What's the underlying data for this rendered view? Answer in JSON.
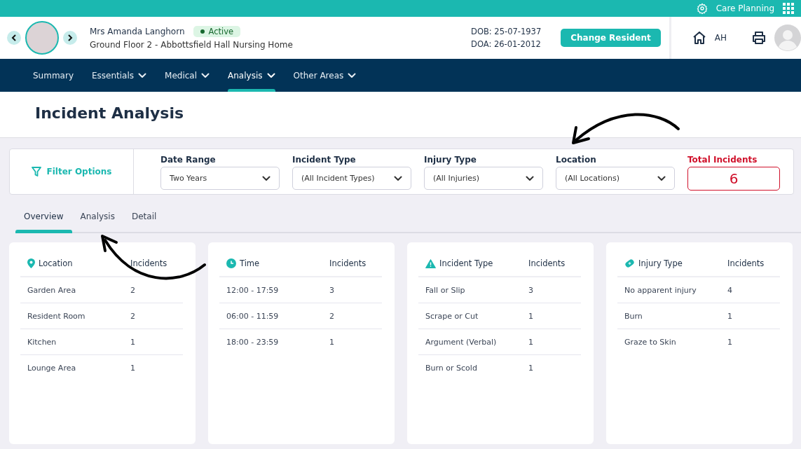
{
  "top_bar": {
    "app_label": "Care Planning"
  },
  "resident": {
    "name": "Mrs Amanda Langhorn",
    "status": "Active",
    "location": "Ground Floor 2 - Abbottsfield Hall Nursing Home",
    "dob": "DOB: 25-07-1937",
    "doa": "DOA: 26-01-2012",
    "change_button": "Change Resident",
    "user_initials": "AH"
  },
  "nav": [
    {
      "label": "Summary",
      "dropdown": false,
      "selected": false
    },
    {
      "label": "Essentials",
      "dropdown": true,
      "selected": false
    },
    {
      "label": "Medical",
      "dropdown": true,
      "selected": false
    },
    {
      "label": "Analysis",
      "dropdown": true,
      "selected": true
    },
    {
      "label": "Other Areas",
      "dropdown": true,
      "selected": false
    }
  ],
  "page_title": "Incident Analysis",
  "filters": {
    "title": "Filter Options",
    "fields": [
      {
        "label": "Date Range",
        "value": "Two Years"
      },
      {
        "label": "Incident Type",
        "value": "(All Incident Types)"
      },
      {
        "label": "Injury Type",
        "value": "(All Injuries)"
      },
      {
        "label": "Location",
        "value": "(All Locations)"
      }
    ],
    "total": {
      "label": "Total Incidents",
      "value": "6"
    }
  },
  "tabs": [
    {
      "label": "Overview",
      "selected": true
    },
    {
      "label": "Analysis",
      "selected": false
    },
    {
      "label": "Detail",
      "selected": false
    }
  ],
  "cards": [
    {
      "kind": "pin",
      "title": "Location",
      "count_header": "Incidents",
      "rows": [
        {
          "name": "Garden Area",
          "count": "2"
        },
        {
          "name": "Resident Room",
          "count": "2"
        },
        {
          "name": "Kitchen",
          "count": "1"
        },
        {
          "name": "Lounge Area",
          "count": "1"
        }
      ]
    },
    {
      "kind": "clock",
      "title": "Time",
      "count_header": "Incidents",
      "rows": [
        {
          "name": "12:00 - 17:59",
          "count": "3"
        },
        {
          "name": "06:00 - 11:59",
          "count": "2"
        },
        {
          "name": "18:00 - 23:59",
          "count": "1"
        }
      ]
    },
    {
      "kind": "warning",
      "title": "Incident Type",
      "count_header": "Incidents",
      "rows": [
        {
          "name": "Fall or Slip",
          "count": "3"
        },
        {
          "name": "Scrape or Cut",
          "count": "1"
        },
        {
          "name": "Argument (Verbal)",
          "count": "1"
        },
        {
          "name": "Burn or Scold",
          "count": "1"
        }
      ]
    },
    {
      "kind": "bandage",
      "title": "Injury Type",
      "count_header": "Incidents",
      "rows": [
        {
          "name": "No apparent injury",
          "count": "4"
        },
        {
          "name": "Burn",
          "count": "1"
        },
        {
          "name": "Graze to Skin",
          "count": "1"
        }
      ]
    }
  ]
}
